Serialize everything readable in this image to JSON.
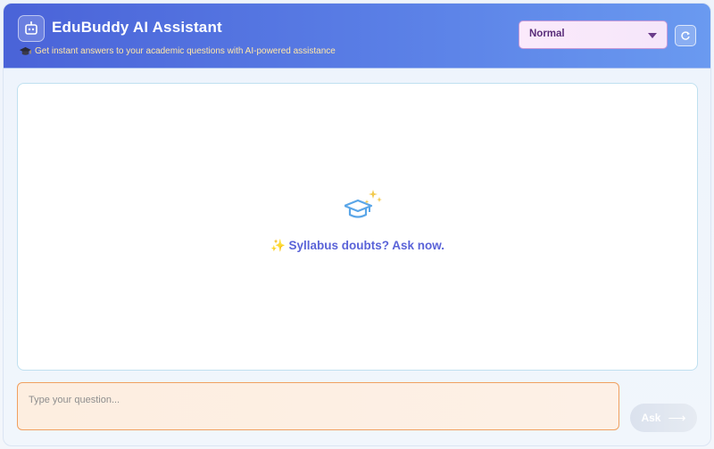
{
  "header": {
    "title": "EduBuddy AI Assistant",
    "subtitle": "Get instant answers to your academic questions with AI-powered assistance",
    "logo_icon": "robot-icon",
    "subtitle_icon": "graduation-cap-icon",
    "mode_select": {
      "value": "Normal"
    },
    "refresh_icon": "refresh-icon"
  },
  "chat": {
    "empty_state_text": "✨ Syllabus doubts? Ask now.",
    "empty_state_icon": "graduation-cap-sparkle-icon"
  },
  "composer": {
    "placeholder": "Type your question...",
    "ask_label": "Ask",
    "ask_arrow": "⟶"
  },
  "colors": {
    "header_start": "#4a63d8",
    "header_end": "#6a9af0",
    "accent_text": "#5a63d8",
    "input_border": "#f0a060",
    "subtitle_text": "#ffe7a8"
  }
}
